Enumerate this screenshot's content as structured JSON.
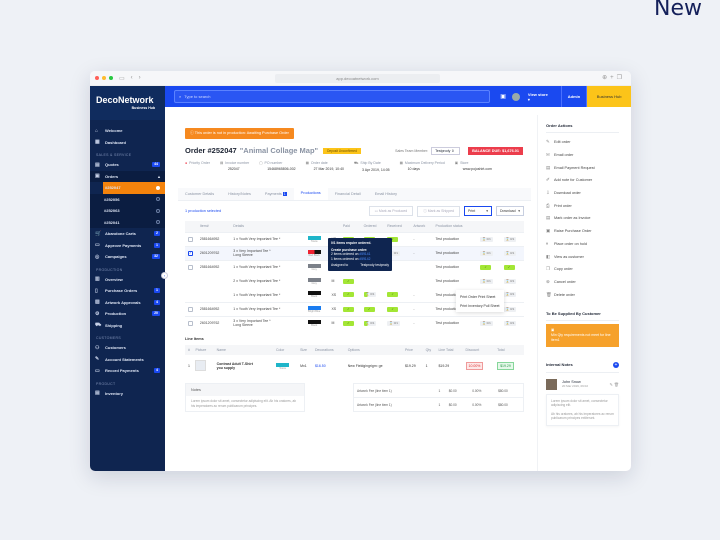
{
  "corner_label": "New",
  "browser": {
    "url": "app.decoatnetwork.com"
  },
  "topbar": {
    "search_placeholder": "Type to search",
    "view_store": "View store ▾",
    "admin": "Admin",
    "business_hub": "Business Hub"
  },
  "brand": {
    "name": "DecoNetwork",
    "sub": "Business Hub"
  },
  "sidebar": {
    "top": [
      {
        "label": "Welcome",
        "icon": "⌂"
      },
      {
        "label": "Dashboard",
        "icon": "▦"
      }
    ],
    "sec1": "SALES & SERVICE",
    "quotes": {
      "label": "Quotes",
      "badge": "44",
      "icon": "▤"
    },
    "orders": {
      "label": "Orders",
      "icon": "▣"
    },
    "order_items": [
      "#252047",
      "#252056",
      "#252063",
      "#252041"
    ],
    "sales_rest": [
      {
        "label": "Abandone Carts",
        "badge": "2",
        "icon": "🛒"
      },
      {
        "label": "Approve Payments",
        "badge": "1",
        "icon": "▭"
      },
      {
        "label": "Campaigns",
        "badge": "32",
        "icon": "◎"
      }
    ],
    "sec2": "PRODUCTION",
    "production": [
      {
        "label": "Overview",
        "icon": "▥",
        "badge": ""
      },
      {
        "label": "Purchase Orders",
        "icon": "▯",
        "badge": "1"
      },
      {
        "label": "Artwork Approvals",
        "icon": "▨",
        "badge": "4"
      },
      {
        "label": "Production",
        "icon": "⚙",
        "badge": "20"
      },
      {
        "label": "Shipping",
        "icon": "⛟",
        "badge": ""
      }
    ],
    "sec3": "CUSTOMERS",
    "customers": [
      {
        "label": "Customers",
        "icon": "⚇",
        "badge": ""
      },
      {
        "label": "Account Statements",
        "icon": "✎",
        "badge": ""
      },
      {
        "label": "Record Payments",
        "icon": "▭",
        "badge": "4"
      }
    ],
    "sec4": "PRODUCT",
    "product": [
      {
        "label": "Inventory",
        "icon": "▤"
      }
    ]
  },
  "order": {
    "alert": "This order is not in production: Awaiting Purchase Order",
    "number": "Order #252047",
    "name": "\"Animal Collage Map\"",
    "deposit": "Deposit Unconfirmed",
    "sales_team_label": "Sales Team Member:",
    "sales_team_value": "Testprody",
    "balance": "BALANCE DUE: $1,676.01",
    "meta": [
      {
        "label": "Priority Order",
        "value": "",
        "icon": "●"
      },
      {
        "label": "Invoice number",
        "value": "252047",
        "icon": "▤"
      },
      {
        "label": "PO number",
        "value": "15468965806-002",
        "icon": "▢"
      },
      {
        "label": "Order date",
        "value": "27 Mar 2019, 10:40",
        "icon": "▦"
      },
      {
        "label": "Ship By Date",
        "value": "3 Apr 2019, 14:05",
        "icon": "⛟"
      },
      {
        "label": "Maximum Delivery Period",
        "value": "10 days",
        "icon": "▦"
      },
      {
        "label": "Store",
        "value": "www.pojoshirt.com",
        "icon": "▣"
      }
    ]
  },
  "tabs": [
    {
      "label": "Customer Details"
    },
    {
      "label": "History/Notes"
    },
    {
      "label": "Payments",
      "badge": "1"
    },
    {
      "label": "Productions"
    },
    {
      "label": "Financial Detail"
    },
    {
      "label": "Email History"
    }
  ],
  "productions": {
    "selected": "1 production selected",
    "mark_produced": "Mark as Produced",
    "mark_shipped": "Mark as Shipped",
    "print": "Print",
    "download": "Download",
    "print_menu": [
      "Print Order Print Sheet",
      "Print Inventory Pull Sheet"
    ],
    "columns": [
      "Item#",
      "Details",
      "",
      "",
      "Paid",
      "Ordered",
      "Received",
      "Artwork",
      "Production status",
      "",
      ""
    ],
    "rows": [
      {
        "item": "2581664952",
        "details": "1 x Youth Very Important Tee *",
        "details2": "",
        "color": "#1fb5c9",
        "color_label": "Tosca",
        "size": "XS",
        "paid": "✓",
        "ordered": "✓",
        "received": "✓",
        "artwork": "-",
        "status": "Test production",
        "c1": "0/1",
        "c2": "0/1",
        "check": "",
        "grp": true
      },
      {
        "item": "2601209762",
        "details": "3 x Very Important Tee *",
        "details2": "Long Sleeve",
        "color": "#e23",
        "color2": "#111",
        "color_label": "Red Black",
        "size": "M",
        "paid": "✓",
        "ordered": "0/1",
        "received": "0/1",
        "artwork": "-",
        "status": "Test production",
        "c1": "0/1",
        "c2": "0/1",
        "check": "✓",
        "grp": true,
        "hl": true
      },
      {
        "item": "2581664952",
        "details": "1 x Youth Very Important Tee *",
        "details2": "",
        "color": "#7b8089",
        "color_label": "Grey",
        "size": "M",
        "paid": "✓",
        "ordered": "",
        "received": "",
        "artwork": "",
        "status": "Test production",
        "c1": "✓",
        "c2": "✓",
        "check": "",
        "grp": true
      },
      {
        "item": "",
        "details": "2 x Youth Very Important Tee *",
        "details2": "",
        "color": "#7b8089",
        "color_label": "Grey",
        "size": "M",
        "paid": "✓",
        "ordered": "",
        "received": "",
        "artwork": "",
        "status": "Test production",
        "c1": "0/1",
        "c2": "0/1",
        "check": "",
        "none": true
      },
      {
        "item": "",
        "details": "1 x Youth Very Important Tee *",
        "details2": "",
        "color": "#111",
        "color_label": "Black",
        "size": "XS",
        "paid": "✓",
        "ordered": "0/1",
        "received": "✓",
        "artwork": "-",
        "status": "Test production",
        "c1": "0/1",
        "c2": "0/1",
        "check": "",
        "none": true
      },
      {
        "item": "2581664952",
        "details": "1 x Youth Very Important Tee *",
        "details2": "",
        "color": "#1a7cf0",
        "color_label": "Bright Blue",
        "size": "XS",
        "paid": "✓",
        "ordered": "✓",
        "received": "✓",
        "artwork": "-",
        "status": "Test production",
        "c1": "0/1",
        "c2": "0/1",
        "check": "",
        "grp": true
      },
      {
        "item": "2601209762",
        "details": "3 x Very Important Tee *",
        "details2": "Long Sleeve",
        "color": "#111",
        "color_label": "Black",
        "size": "M",
        "paid": "✓",
        "ordered": "0/1",
        "received": "0/1",
        "artwork": "-",
        "status": "Test production",
        "c1": "0/1",
        "c2": "0/1",
        "check": "",
        "grp": true
      }
    ],
    "tooltip": {
      "line1": "0/1 items require ordered.",
      "line2": "Create purchase order:",
      "line3a": "2 items ordered on",
      "link1": "#59141",
      "line4a": "1 items ordered on",
      "link2": "#59142",
      "assigned_label": "Assigned to",
      "assigned_value": "Testprody testprody"
    }
  },
  "line_items": {
    "title": "Line Items",
    "columns": [
      "#",
      "Picture",
      "Name",
      "Color",
      "Size",
      "Decorations",
      "Options",
      "Price",
      "Qty",
      "Line Total",
      "Discount",
      "Total"
    ],
    "rows": [
      {
        "n": "1",
        "name": "Contrast Adult T-Shirt",
        "name2": "you supply",
        "color": "#1fb5c9",
        "color_label": "Tosca",
        "size": "Mx1",
        "decorations": "$16.50",
        "options": "New Fieldgingrigm: ge",
        "price": "$19.29",
        "qty": "1",
        "line_total": "$19.29",
        "discount": "10.00%",
        "total": "$19.29"
      }
    ],
    "notes_title": "Notes",
    "notes_body": "Lorem ipsum dolor sit amet, consectetur adipiscing elit. Ab his oratores, ab his imperatores ac rerum publicarum principes.",
    "fees": [
      {
        "name": "Artwork Fee (line item 1)",
        "qty": "1",
        "price": "$0.00",
        "pct": "0.00%",
        "total": "$80.00"
      },
      {
        "name": "Artwork Fee (line item 1)",
        "qty": "1",
        "price": "$0.00",
        "pct": "0.00%",
        "total": "$80.00"
      }
    ]
  },
  "order_actions": {
    "title": "Order Actions",
    "items": [
      {
        "label": "Edit order",
        "icon": "✎"
      },
      {
        "label": "Email order",
        "icon": "✉"
      },
      {
        "label": "Email Payment Request",
        "icon": "▤"
      },
      {
        "label": "Add note for Customer",
        "icon": "✐"
      },
      {
        "label": "Download order",
        "icon": "⇩"
      },
      {
        "label": "Print order",
        "icon": "⎙"
      },
      {
        "label": "Mark order as Invoice",
        "icon": "▤"
      },
      {
        "label": "Raise Purchase Order",
        "icon": "▣"
      },
      {
        "label": "Place order on hold",
        "icon": "⏸"
      },
      {
        "label": "View as customer",
        "icon": "◧"
      },
      {
        "label": "Copy order",
        "icon": "❐"
      },
      {
        "label": "Cancel order",
        "icon": "⊗"
      },
      {
        "label": "Delete order",
        "icon": "🗑"
      }
    ]
  },
  "supplied": {
    "title": "To Be Supplied By Customer",
    "message": "Min Qty requirements not meet for line item1"
  },
  "internal_notes": {
    "title": "Internal Notes",
    "author": "John Snow",
    "date": "20 Mar 2019, 09:02",
    "p1": "Lorem ipsum dolor sit amet, consectetur adipiscing elit.",
    "p2": "Ab his oratores, ab his imperatores ac rerum publicarum principes extiterunt."
  }
}
